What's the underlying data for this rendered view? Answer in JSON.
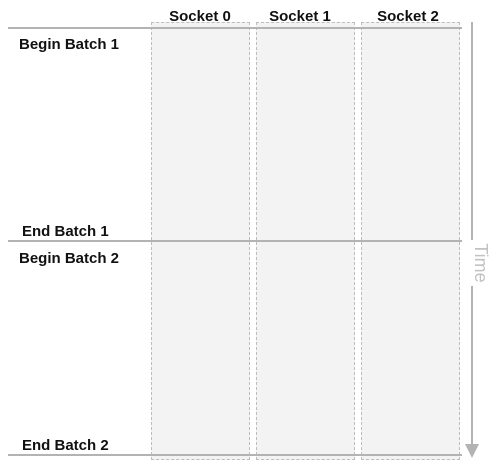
{
  "columns": [
    {
      "label": "Socket 0"
    },
    {
      "label": "Socket 1"
    },
    {
      "label": "Socket 2"
    }
  ],
  "rows": {
    "begin_batch_1": "Begin Batch 1",
    "end_batch_1": "End Batch 1",
    "begin_batch_2": "Begin Batch 2",
    "end_batch_2": "End Batch 2"
  },
  "time_axis": {
    "label": "Time",
    "direction": "down"
  },
  "colors": {
    "column_fill": "#f3f3f3",
    "column_border": "#bdbdbd",
    "divider": "#b3b3b3",
    "arrow": "#b3b3b3",
    "time_label": "#c2c2c2"
  }
}
